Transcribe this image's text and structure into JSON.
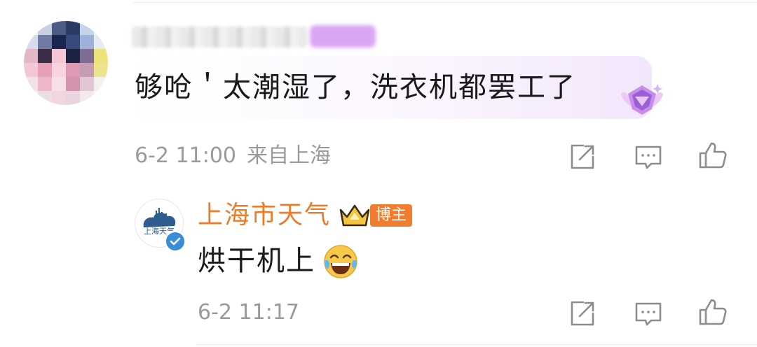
{
  "comment": {
    "avatar_icon": "pixelated-avatar",
    "username": "",
    "text": "够呛＇太潮湿了，洗衣机都罢工了",
    "time": "6-2 11:00",
    "location": "来自上海",
    "icons": {
      "share": "share-icon",
      "reply": "comment-icon",
      "like": "like-icon",
      "badge": "gem-badge-icon"
    }
  },
  "reply": {
    "author": "上海市天气",
    "avatar_logo_text": "上海天气",
    "role_badge": "博主",
    "text": "烘干机上",
    "emoji": "laughing-tears-emoji",
    "time": "6-2 11:17",
    "icons": {
      "share": "share-icon",
      "reply": "comment-icon",
      "like": "like-icon",
      "crown": "crown-icon",
      "verified": "verified-icon"
    }
  },
  "colors": {
    "author_name": "#ea7c2a",
    "blogger_tag_bg": "#ef7d2d",
    "meta_text": "#9a9a9a",
    "body_text": "#1a1a1a",
    "verified_blue": "#3a8bd8"
  }
}
